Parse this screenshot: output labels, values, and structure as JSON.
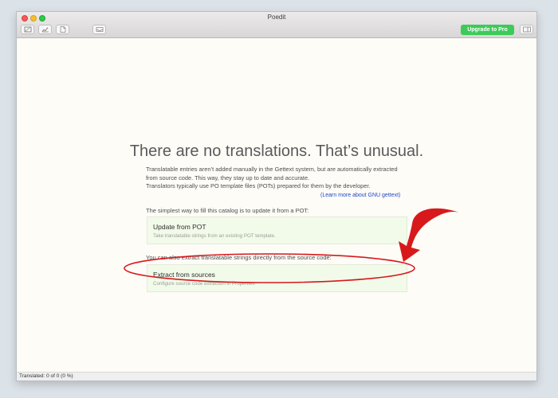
{
  "window": {
    "title": "Poedit",
    "upgrade_label": "Upgrade to Pro"
  },
  "toolbar": {
    "icons": [
      "window-icon",
      "chart-icon",
      "document-icon",
      "inbox-icon",
      "sidebar-icon"
    ]
  },
  "empty_state": {
    "headline": "There are no translations. That’s unusual.",
    "description_line1": "Translatable entries aren’t added manually in the Gettext system, but are automatically extracted",
    "description_line2": "from source code. This way, they stay up to date and accurate.",
    "description_line3": "Translators typically use PO template files (POTs) prepared for them by the developer.",
    "learn_more": "(Learn more about GNU gettext)",
    "update_intro": "The simplest way to fill this catalog is to update it from a POT:",
    "update_title": "Update from POT",
    "update_subtitle": "Take translatable strings from an existing POT template.",
    "extract_intro": "You can also extract translatable strings directly from the source code:",
    "extract_title": "Extract from sources",
    "extract_subtitle": "Configure source code extraction in Properties."
  },
  "status": {
    "text": "Translated: 0 of 0 (0 %)"
  },
  "annotation": {
    "color": "#d7191c"
  }
}
